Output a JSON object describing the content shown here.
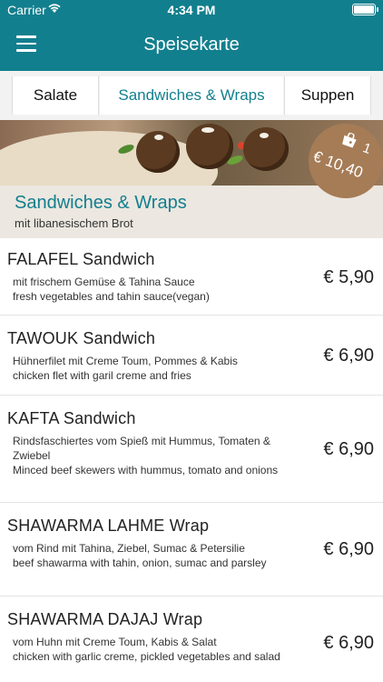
{
  "status_bar": {
    "carrier": "Carrier",
    "time": "4:34 PM"
  },
  "nav": {
    "title": "Speisekarte"
  },
  "tabs": [
    "Salate",
    "Sandwiches & Wraps",
    "Suppen"
  ],
  "section": {
    "title": "Sandwiches & Wraps",
    "subtitle": "mit libanesischem Brot"
  },
  "cart": {
    "count": "1",
    "total": "€ 10,40"
  },
  "items": [
    {
      "name": "FALAFEL Sandwich",
      "desc_de": "mit frischem Gemüse & Tahina Sauce",
      "desc_en": "fresh vegetables and tahin sauce(vegan)",
      "price": "€ 5,90"
    },
    {
      "name": "TAWOUK Sandwich",
      "desc_de": "Hühnerfilet mit Creme Toum, Pommes & Kabis",
      "desc_en": "chicken flet with garil creme and fries",
      "price": "€ 6,90"
    },
    {
      "name": "KAFTA Sandwich",
      "desc_de": "Rindsfaschiertes vom Spieß mit Hummus, Tomaten & Zwiebel",
      "desc_en": "Minced beef skewers with hummus, tomato and onions",
      "price": "€ 6,90"
    },
    {
      "name": "SHAWARMA LAHME Wrap",
      "desc_de": "vom Rind mit Tahina, Ziebel, Sumac & Petersilie",
      "desc_en": "beef shawarma with tahin, onion, sumac and parsley",
      "price": "€ 6,90"
    },
    {
      "name": "SHAWARMA DAJAJ Wrap",
      "desc_de": "vom Huhn mit Creme Toum, Kabis & Salat",
      "desc_en": "chicken with garlic creme, pickled vegetables and salad",
      "price": "€ 6,90"
    }
  ]
}
